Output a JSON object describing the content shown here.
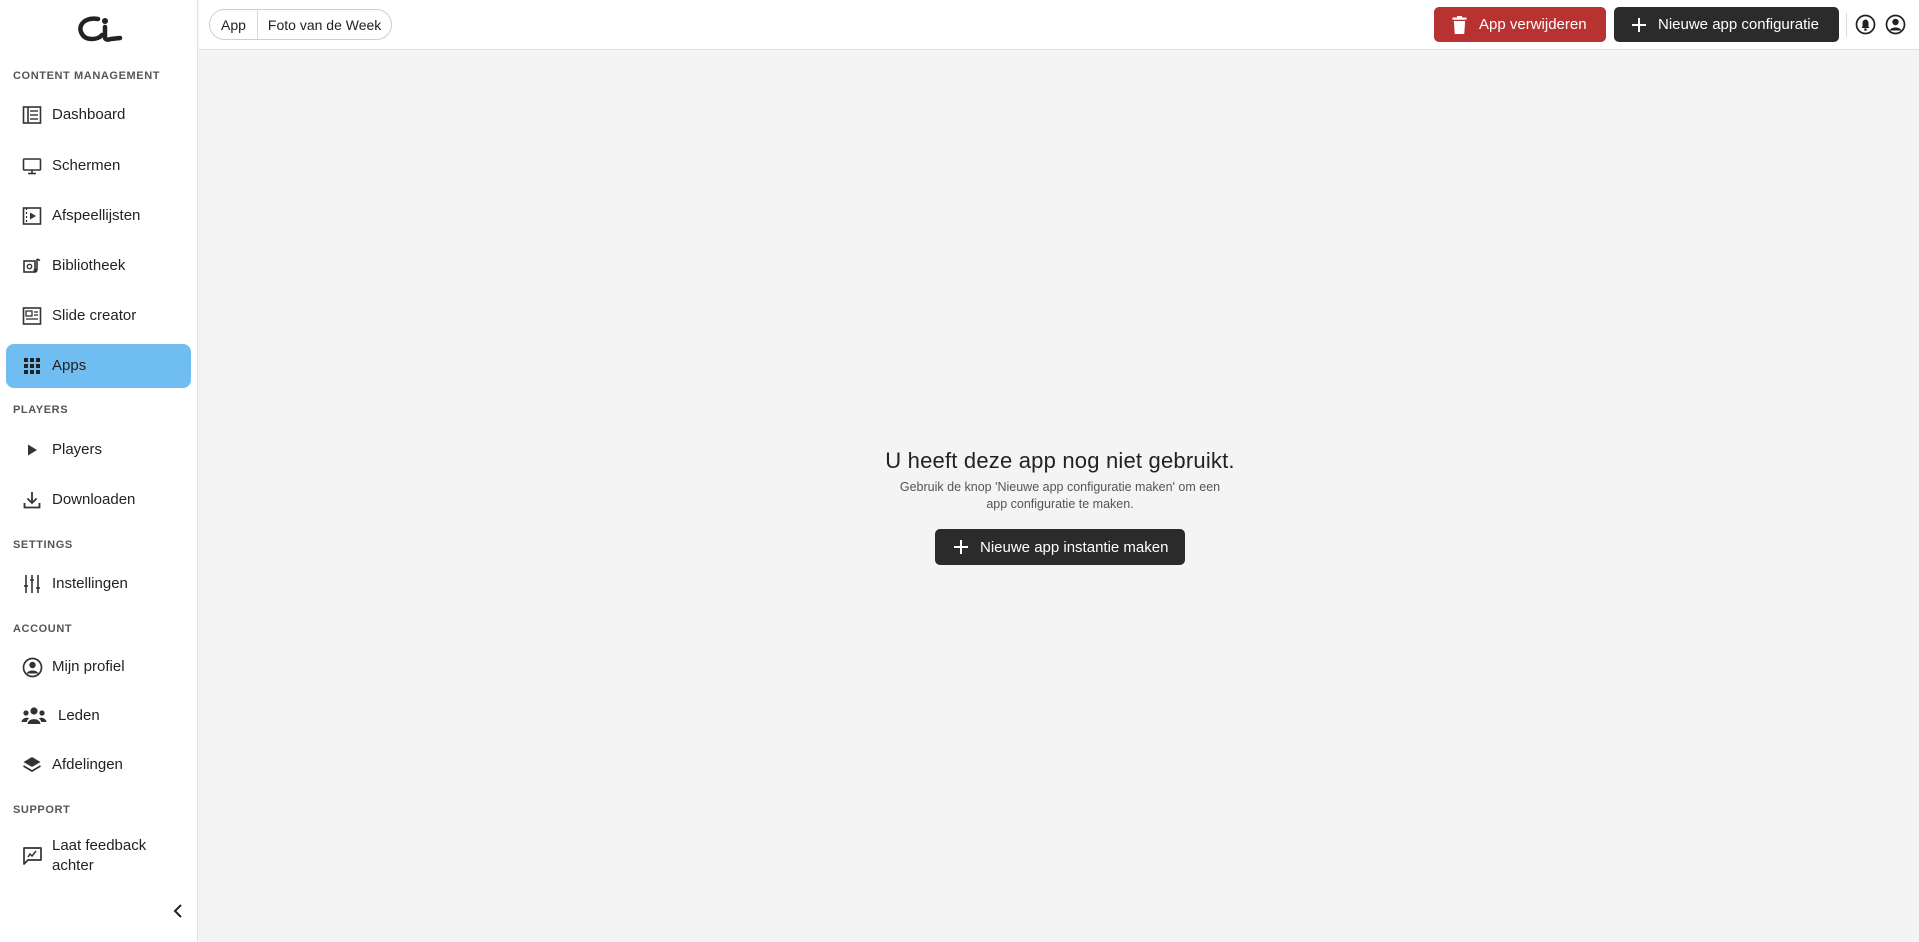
{
  "sidebar": {
    "sections": {
      "content": "CONTENT MANAGEMENT",
      "players": "PLAYERS",
      "settings": "SETTINGS",
      "account": "ACCOUNT",
      "support": "SUPPORT"
    },
    "items": [
      {
        "label": "Dashboard",
        "icon": "dashboard-icon"
      },
      {
        "label": "Schermen",
        "icon": "monitor-icon"
      },
      {
        "label": "Afspeellijsten",
        "icon": "playlist-icon"
      },
      {
        "label": "Bibliotheek",
        "icon": "library-icon"
      },
      {
        "label": "Slide creator",
        "icon": "slide-creator-icon"
      },
      {
        "label": "Apps",
        "icon": "apps-grid-icon",
        "active": true
      },
      {
        "label": "Players",
        "icon": "play-icon"
      },
      {
        "label": "Downloaden",
        "icon": "download-icon"
      },
      {
        "label": "Instellingen",
        "icon": "sliders-icon"
      },
      {
        "label": "Mijn profiel",
        "icon": "user-circle-icon"
      },
      {
        "label": "Leden",
        "icon": "users-icon"
      },
      {
        "label": "Afdelingen",
        "icon": "layers-icon"
      },
      {
        "label": "Laat feedback achter",
        "icon": "feedback-icon"
      }
    ]
  },
  "breadcrumb": {
    "root": "App",
    "current": "Foto van de Week"
  },
  "toolbar": {
    "delete_label": "App verwijderen",
    "new_config_label": "Nieuwe app configuratie"
  },
  "empty_state": {
    "title": "U heeft deze app nog niet gebruikt.",
    "description": "Gebruik de knop 'Nieuwe app configuratie maken' om een app configuratie te maken.",
    "button_label": "Nieuwe app instantie maken"
  },
  "colors": {
    "active_nav": "#6fbdf1",
    "danger": "#b83232",
    "dark_button": "#2b2b2b",
    "background": "#f4f4f4"
  }
}
